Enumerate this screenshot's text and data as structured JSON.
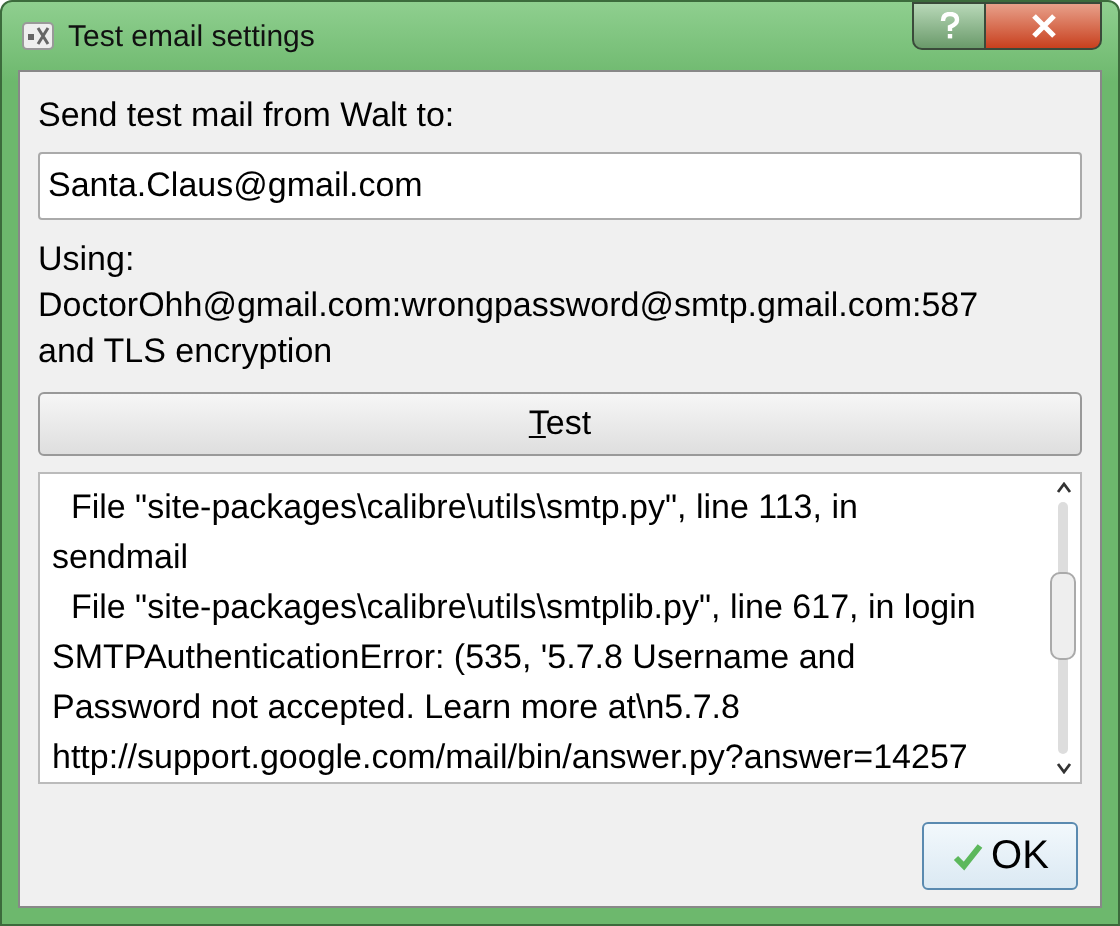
{
  "window": {
    "title": "Test email settings"
  },
  "prompt": "Send test mail from Walt to:",
  "recipient": {
    "value": "Santa.Claus@gmail.com"
  },
  "using_lines": [
    "Using:",
    "DoctorOhh@gmail.com:wrongpassword@smtp.gmail.com:587",
    "and TLS encryption"
  ],
  "test_button": {
    "label": "Test"
  },
  "log_lines": [
    "  File \"site-packages\\calibre\\utils\\smtp.py\", line 113, in",
    "sendmail",
    "  File \"site-packages\\calibre\\utils\\smtplib.py\", line 617, in login",
    "SMTPAuthenticationError: (535, '5.7.8 Username and",
    "Password not accepted. Learn more at\\n5.7.8",
    "http://support.google.com/mail/bin/answer.py?answer=14257"
  ],
  "ok_button": {
    "label": "OK"
  }
}
